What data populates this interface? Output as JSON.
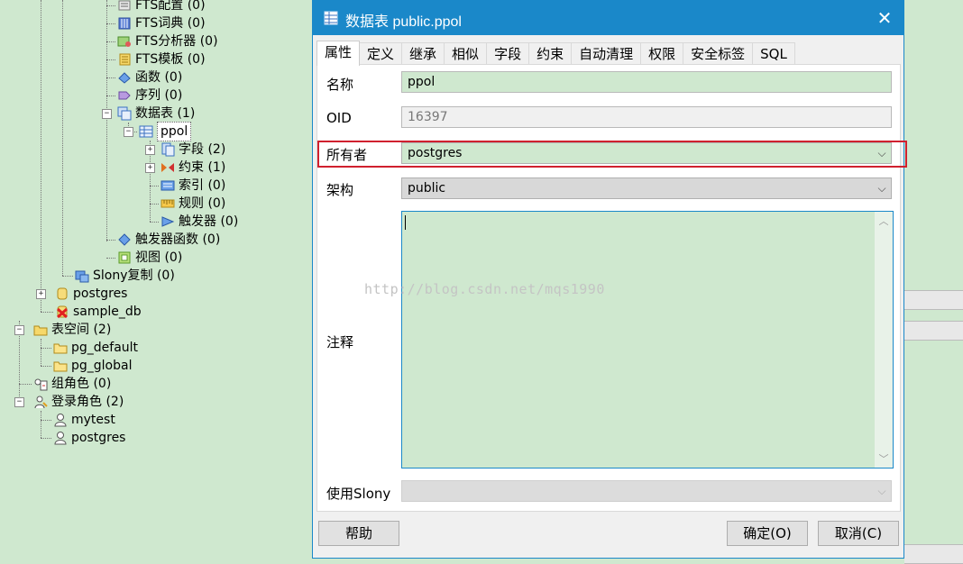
{
  "tree": [
    {
      "label": "FTS配置 (0)",
      "icon": "fts-config-icon"
    },
    {
      "label": "FTS词典 (0)",
      "icon": "fts-dictionary-icon"
    },
    {
      "label": "FTS分析器 (0)",
      "icon": "fts-parser-icon"
    },
    {
      "label": "FTS模板 (0)",
      "icon": "fts-template-icon"
    },
    {
      "label": "函数 (0)",
      "icon": "function-icon"
    },
    {
      "label": "序列 (0)",
      "icon": "sequence-icon"
    },
    {
      "label": "数据表 (1)",
      "icon": "tables-icon"
    },
    {
      "label": "ppol",
      "icon": "table-icon"
    },
    {
      "label": "字段 (2)",
      "icon": "columns-icon"
    },
    {
      "label": "约束 (1)",
      "icon": "constraints-icon"
    },
    {
      "label": "索引 (0)",
      "icon": "indexes-icon"
    },
    {
      "label": "规则 (0)",
      "icon": "rules-icon"
    },
    {
      "label": "触发器 (0)",
      "icon": "triggers-icon"
    },
    {
      "label": "触发器函数 (0)",
      "icon": "trigger-functions-icon"
    },
    {
      "label": "视图 (0)",
      "icon": "views-icon"
    },
    {
      "label": "Slony复制 (0)",
      "icon": "slony-icon"
    },
    {
      "label": "postgres",
      "icon": "database-icon"
    },
    {
      "label": "sample_db",
      "icon": "database-disconnected-icon"
    },
    {
      "label": "表空间 (2)",
      "icon": "tablespaces-icon"
    },
    {
      "label": "pg_default",
      "icon": "tablespace-icon"
    },
    {
      "label": "pg_global",
      "icon": "tablespace-icon"
    },
    {
      "label": "组角色 (0)",
      "icon": "group-roles-icon"
    },
    {
      "label": "登录角色 (2)",
      "icon": "login-roles-icon"
    },
    {
      "label": "mytest",
      "icon": "user-icon"
    },
    {
      "label": "postgres",
      "icon": "user-icon"
    }
  ],
  "dialog": {
    "title": "数据表 public.ppol",
    "close_glyph": "✕",
    "tabs": [
      "属性",
      "定义",
      "继承",
      "相似",
      "字段",
      "约束",
      "自动清理",
      "权限",
      "安全标签",
      "SQL"
    ],
    "active_tab": "属性",
    "fields": {
      "name_label": "名称",
      "name_value": "ppol",
      "oid_label": "OID",
      "oid_value": "16397",
      "owner_label": "所有者",
      "owner_value": "postgres",
      "schema_label": "架构",
      "schema_value": "public",
      "comment_label": "注释",
      "comment_value": "",
      "slony_label": "使用Slony",
      "slony_value": ""
    },
    "buttons": {
      "help": "帮助",
      "ok": "确定(O)",
      "cancel": "取消(C)"
    }
  },
  "watermark": "http://blog.csdn.net/mqs1990",
  "colors": {
    "accent": "#1a88c9",
    "highlight": "#d0202e",
    "field_bg": "#cfe8cf"
  }
}
